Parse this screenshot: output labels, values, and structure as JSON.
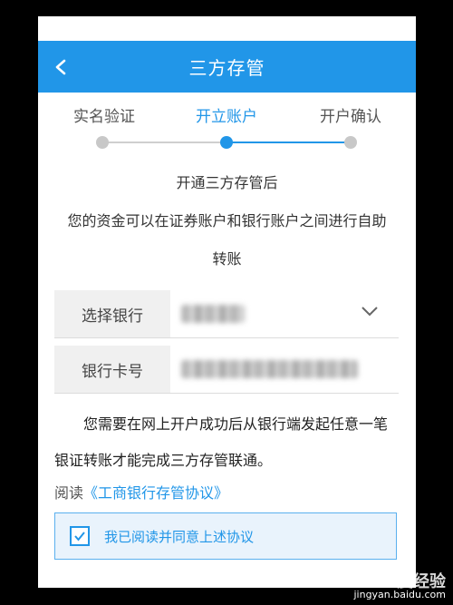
{
  "header": {
    "title": "三方存管"
  },
  "steps": [
    {
      "label": "实名验证",
      "active": false
    },
    {
      "label": "开立账户",
      "active": true
    },
    {
      "label": "开户确认",
      "active": false
    }
  ],
  "intro": {
    "line1": "开通三方存管后",
    "line2": "您的资金可以在证券账户和银行账户之间进行自助",
    "line3": "转账"
  },
  "form": {
    "bank_label": "选择银行",
    "card_label": "银行卡号"
  },
  "notice": "您需要在网上开户成功后从银行端发起任意一笔银证转账才能完成三方存管联通。",
  "agreement": {
    "read_prefix": "阅读",
    "link_text": "《工商银行存管协议》",
    "checkbox_text": "我已阅读并同意上述协议",
    "checked": true
  },
  "watermark": {
    "brand": "Bai度经验",
    "url": "jingyan.baidu.com"
  },
  "colors": {
    "accent": "#2196e8",
    "header_bg": "#2196e8"
  }
}
